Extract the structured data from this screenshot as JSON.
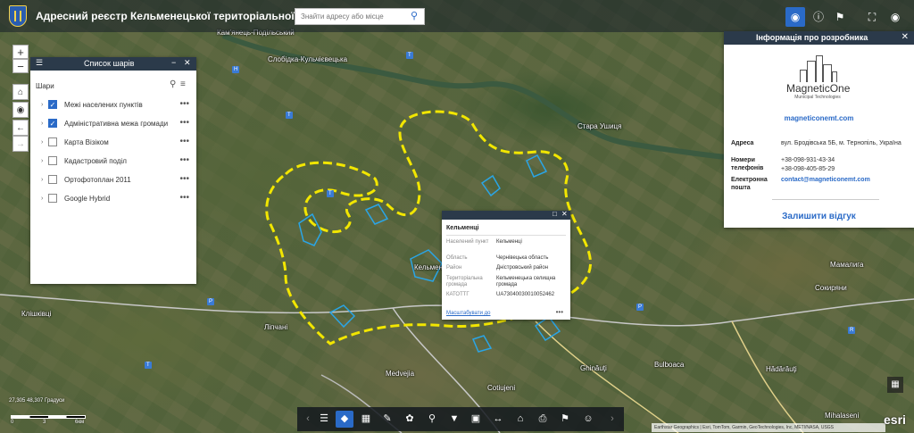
{
  "header": {
    "title": "Адресний реєстр Кельменецької територіальної громади",
    "search_placeholder": "Знайти адресу або місце"
  },
  "layer_list": {
    "title": "Список шарів",
    "subheader": "Шари",
    "items": [
      {
        "label": "Межі населених пунктів",
        "checked": true
      },
      {
        "label": "Адміністративна межа громади",
        "checked": true
      },
      {
        "label": "Карта Візіком",
        "checked": false
      },
      {
        "label": "Кадастровий поділ",
        "checked": false
      },
      {
        "label": "Ортофотоплан 2011",
        "checked": false
      },
      {
        "label": "Google Hybrid",
        "checked": false
      }
    ]
  },
  "developer_panel": {
    "title": "Інформація про розробника",
    "brand_name": "MagneticOne",
    "brand_sub": "Municipal Technologies",
    "website": "magneticonemt.com",
    "address_label": "Адреса",
    "address_value": "вул. Бродівська 5Б, м. Тернопіль, Україна",
    "phones_label": "Номери телефонів",
    "phone_1": "+38-098-931-43-34",
    "phone_2": "+38-098-405-85-29",
    "email_label": "Електронна пошта",
    "email_value": "contact@magneticonemt.com",
    "feedback": "Залишити відгук"
  },
  "popup": {
    "title": "Кельменці",
    "rows": [
      {
        "key": "Населений пункт",
        "value": "Кельменці"
      },
      {
        "key": "Область",
        "value": "Чернівецька область"
      },
      {
        "key": "Район",
        "value": "Дністровський район"
      },
      {
        "key": "Територіальна громада",
        "value": "Кельменецька селищна громада"
      },
      {
        "key": "КАТОТТГ",
        "value": "UA73040030010052462"
      }
    ],
    "zoom_link": "Масштабувати до"
  },
  "map": {
    "places": [
      {
        "name": "Кам'янець-Подільський"
      },
      {
        "name": "Слобідка-Кульчієвецька"
      },
      {
        "name": "Стара Ушиця"
      },
      {
        "name": "Кельменці"
      },
      {
        "name": "Ліпчані"
      },
      {
        "name": "Клішківці"
      },
      {
        "name": "Medvejia"
      },
      {
        "name": "Cotiujeni"
      },
      {
        "name": "Ghinăuţi"
      },
      {
        "name": "Bulboaca"
      },
      {
        "name": "Hădărăuţi"
      },
      {
        "name": "Сокиряни"
      },
      {
        "name": "Мамалига"
      },
      {
        "name": "Mihalaseni"
      }
    ],
    "coords": "27,305 48,307 Градуси",
    "scale_labels": [
      "0",
      "3",
      "6км"
    ],
    "attribution": "Earthstar Geographics | Esri, TomTom, Garmin, GeoTechnologies, Inc, METI/NASA, USGS",
    "logo": "esri"
  },
  "icons": {
    "search": "search-icon",
    "layers": "layers-icon",
    "home": "home-icon",
    "locate": "locate-icon"
  },
  "colors": {
    "accent": "#2a6ac7",
    "panel_header": "#2b3a4a",
    "boundary_yellow": "#f2e600",
    "settlement_blue": "#2aa5e6"
  }
}
